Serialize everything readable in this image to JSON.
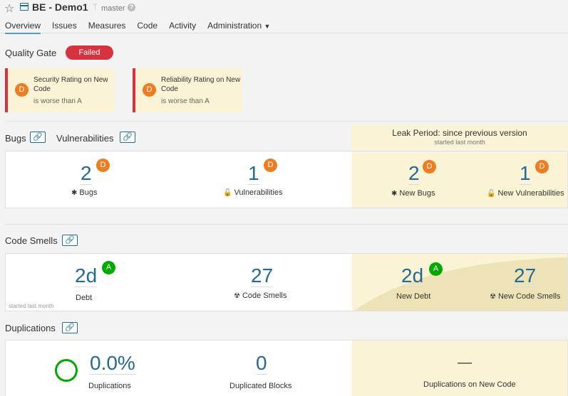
{
  "header": {
    "project_name": "BE - Demo1",
    "branch": "master",
    "tabs": [
      "Overview",
      "Issues",
      "Measures",
      "Code",
      "Activity",
      "Administration"
    ]
  },
  "quality_gate": {
    "title": "Quality Gate",
    "status": "Failed",
    "conditions": [
      {
        "rating": "D",
        "metric": "Security Rating on New Code",
        "detail": "is worse than A"
      },
      {
        "rating": "D",
        "metric": "Reliability Rating on New Code",
        "detail": "is worse than A"
      }
    ]
  },
  "leak_period": {
    "title": "Leak Period: since previous version",
    "subtitle": "started last month"
  },
  "bugs_vulns": {
    "title_bugs": "Bugs",
    "title_vulns": "Vulnerabilities",
    "bugs": {
      "value": "2",
      "rating": "D",
      "label": "Bugs"
    },
    "vulns": {
      "value": "1",
      "rating": "D",
      "label": "Vulnerabilities"
    },
    "new_bugs": {
      "value": "2",
      "rating": "D",
      "label": "New Bugs"
    },
    "new_vulns": {
      "value": "1",
      "rating": "D",
      "label": "New Vulnerabilities"
    }
  },
  "code_smells": {
    "title": "Code Smells",
    "debt": {
      "value": "2d",
      "rating": "A",
      "label": "Debt"
    },
    "smells": {
      "value": "27",
      "label": "Code Smells"
    },
    "new_debt": {
      "value": "2d",
      "rating": "A",
      "label": "New Debt"
    },
    "new_smells": {
      "value": "27",
      "label": "New Code Smells"
    },
    "note": "started last month"
  },
  "duplications": {
    "title": "Duplications",
    "dup": {
      "value": "0.0%",
      "label": "Duplications"
    },
    "blocks": {
      "value": "0",
      "label": "Duplicated Blocks"
    },
    "new_dup": {
      "value": "—",
      "label": "Duplications on New Code"
    }
  },
  "colors": {
    "accent": "#236a97",
    "failed": "#d4333f",
    "rating_d": "#ed7d20",
    "rating_a": "#00aa00",
    "leak": "#fbf3d5"
  }
}
